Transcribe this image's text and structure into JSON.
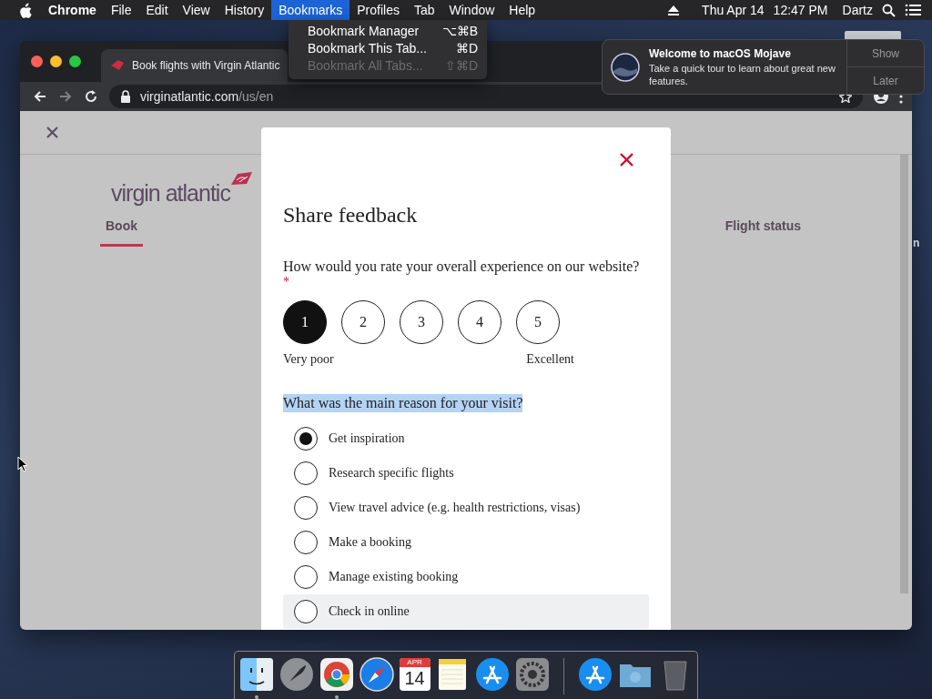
{
  "menu_bar": {
    "menus": [
      {
        "label": "Chrome",
        "kind": "app",
        "selected": false
      },
      {
        "label": "File",
        "kind": "menu",
        "selected": false
      },
      {
        "label": "Edit",
        "kind": "menu",
        "selected": false
      },
      {
        "label": "View",
        "kind": "menu",
        "selected": false
      },
      {
        "label": "History",
        "kind": "menu",
        "selected": false
      },
      {
        "label": "Bookmarks",
        "kind": "menu",
        "selected": true
      },
      {
        "label": "Profiles",
        "kind": "menu",
        "selected": false
      },
      {
        "label": "Tab",
        "kind": "menu",
        "selected": false
      },
      {
        "label": "Window",
        "kind": "menu",
        "selected": false
      },
      {
        "label": "Help",
        "kind": "menu",
        "selected": false
      }
    ],
    "date": "Thu Apr 14",
    "time": "12:47 PM",
    "user": "Dartz"
  },
  "bookmarks_menu": {
    "items": [
      {
        "label": "Bookmark Manager",
        "shortcut": "⌥⌘B",
        "disabled": false
      },
      {
        "label": "Bookmark This Tab...",
        "shortcut": "⌘D",
        "disabled": false
      },
      {
        "label": "Bookmark All Tabs...",
        "shortcut": "⇧⌘D",
        "disabled": true
      }
    ]
  },
  "notification": {
    "title": "Welcome to macOS Mojave",
    "body": "Take a quick tour to learn about great new features.",
    "buttons": [
      "Show",
      "Later"
    ]
  },
  "desktop": {
    "icon_label": "n"
  },
  "browser": {
    "tab_title": "Book flights with Virgin Atlantic",
    "url_host": "virginatlantic.com",
    "url_path": "/us/en"
  },
  "page": {
    "logo": "virgin atlantic",
    "nav": [
      {
        "label": "Book",
        "selected": true
      },
      {
        "label": "Flight status",
        "selected": false
      }
    ]
  },
  "modal": {
    "title": "Share feedback",
    "question": "How would you rate your overall experience on our website?",
    "required_mark": "*",
    "ratings": [
      {
        "label": "1",
        "selected": true
      },
      {
        "label": "2",
        "selected": false
      },
      {
        "label": "3",
        "selected": false
      },
      {
        "label": "4",
        "selected": false
      },
      {
        "label": "5",
        "selected": false
      }
    ],
    "scale_low": "Very poor",
    "scale_high": "Excellent",
    "reason_question": "What was the main reason for your visit?",
    "reason_highlighted": true,
    "options": [
      {
        "label": "Get inspiration",
        "selected": true,
        "hovered": false
      },
      {
        "label": "Research specific flights",
        "selected": false,
        "hovered": false
      },
      {
        "label": "View travel advice (e.g. health restrictions, visas)",
        "selected": false,
        "hovered": false
      },
      {
        "label": "Make a booking",
        "selected": false,
        "hovered": false
      },
      {
        "label": "Manage existing booking",
        "selected": false,
        "hovered": false
      },
      {
        "label": "Check in online",
        "selected": false,
        "hovered": true
      }
    ]
  },
  "dock": {
    "apps": [
      {
        "kind": "finder",
        "running": true
      },
      {
        "kind": "launchpad",
        "running": false
      },
      {
        "kind": "chrome",
        "running": true
      },
      {
        "kind": "safari",
        "running": false
      },
      {
        "kind": "calendar",
        "running": false,
        "month": "APR",
        "day": "14"
      },
      {
        "kind": "notes",
        "running": false
      },
      {
        "kind": "app-store",
        "running": false
      },
      {
        "kind": "system-preferences",
        "running": false
      },
      {
        "kind": "separator"
      },
      {
        "kind": "app-store",
        "running": false
      },
      {
        "kind": "folder",
        "running": false
      },
      {
        "kind": "trash",
        "running": false
      }
    ]
  }
}
